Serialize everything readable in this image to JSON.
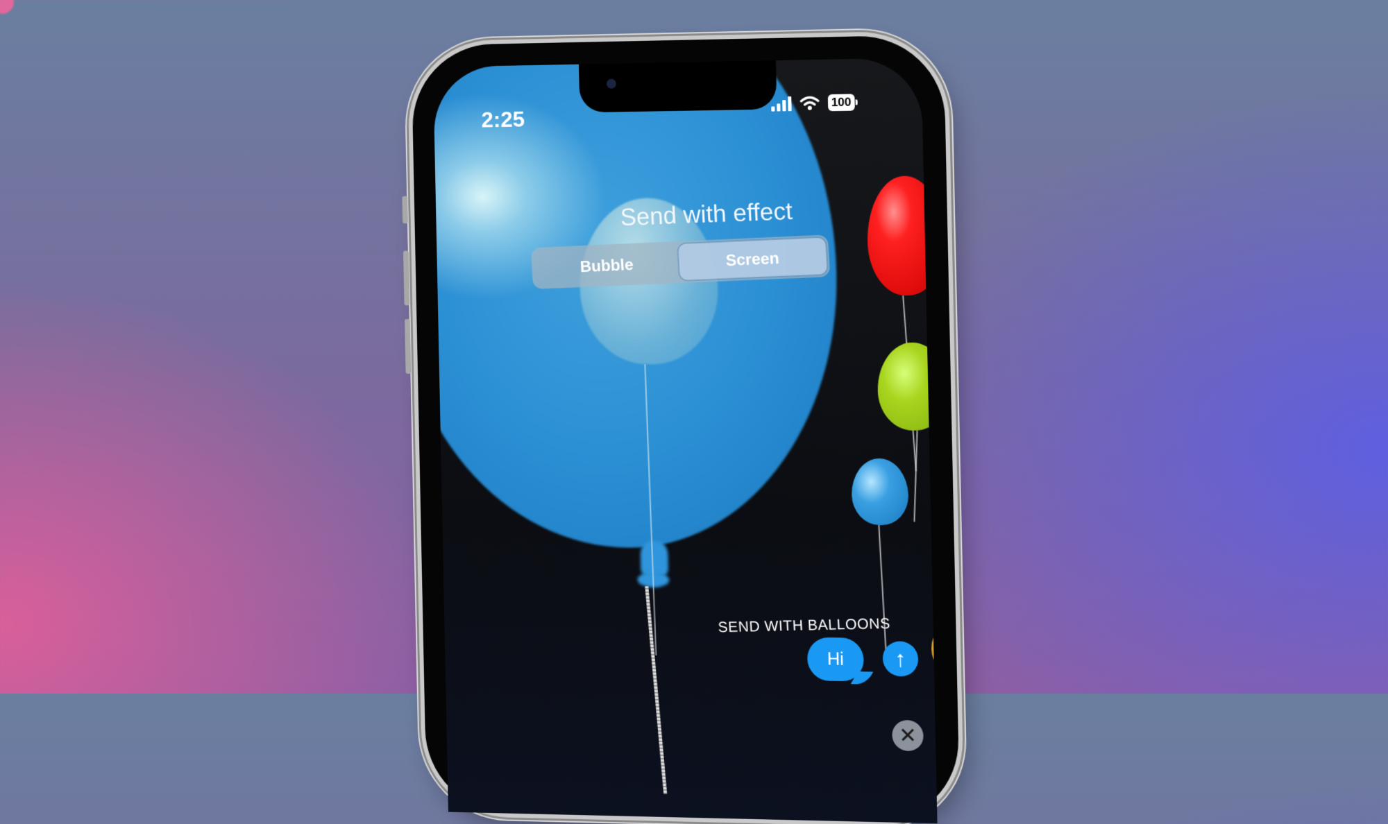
{
  "status_bar": {
    "time": "2:25",
    "battery": "100",
    "icons": [
      "signal-icon",
      "wifi-icon",
      "battery-icon"
    ]
  },
  "effect_picker": {
    "title": "Send with effect",
    "tabs": [
      {
        "label": "Bubble",
        "selected": false
      },
      {
        "label": "Screen",
        "selected": true
      }
    ]
  },
  "preview": {
    "effect_label": "SEND WITH BALLOONS",
    "message_text": "Hi",
    "balloon_colors": [
      "#2b8fd4",
      "#e00c0c",
      "#a9d41e",
      "#3aa0e2",
      "#e0a52a"
    ]
  },
  "buttons": {
    "send_icon": "↑",
    "close_icon": "✕"
  },
  "colors": {
    "imessage_blue": "#1a99f4",
    "close_button": "#8c929b"
  }
}
